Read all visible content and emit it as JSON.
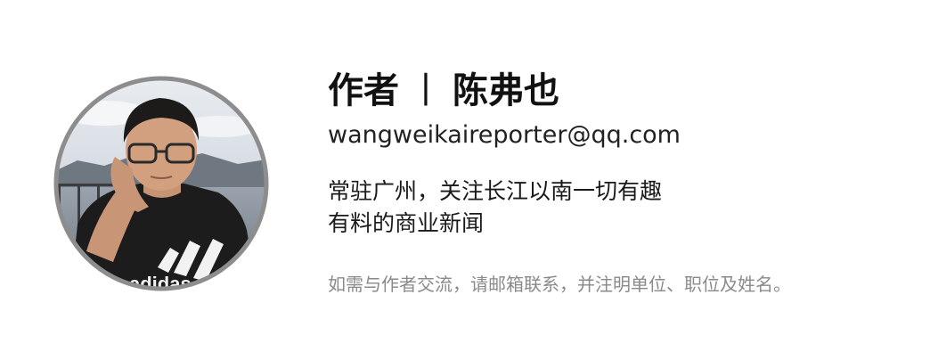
{
  "author": {
    "label": "作者",
    "separator": "丨",
    "name": "陈弗也",
    "email": "wangweikaireporter@qq.com",
    "bio_lines": [
      "常驻广州，关注长江以南一切有趣",
      "有料的商业新闻"
    ],
    "contact_note": "如需与作者交流，请邮箱联系，并注明单位、职位及姓名。",
    "adidas_text": "adidas"
  },
  "colors": {
    "title": "#111111",
    "note": "#8a8a8a",
    "avatar_ring": "#8d8d8d",
    "background": "#ffffff"
  }
}
